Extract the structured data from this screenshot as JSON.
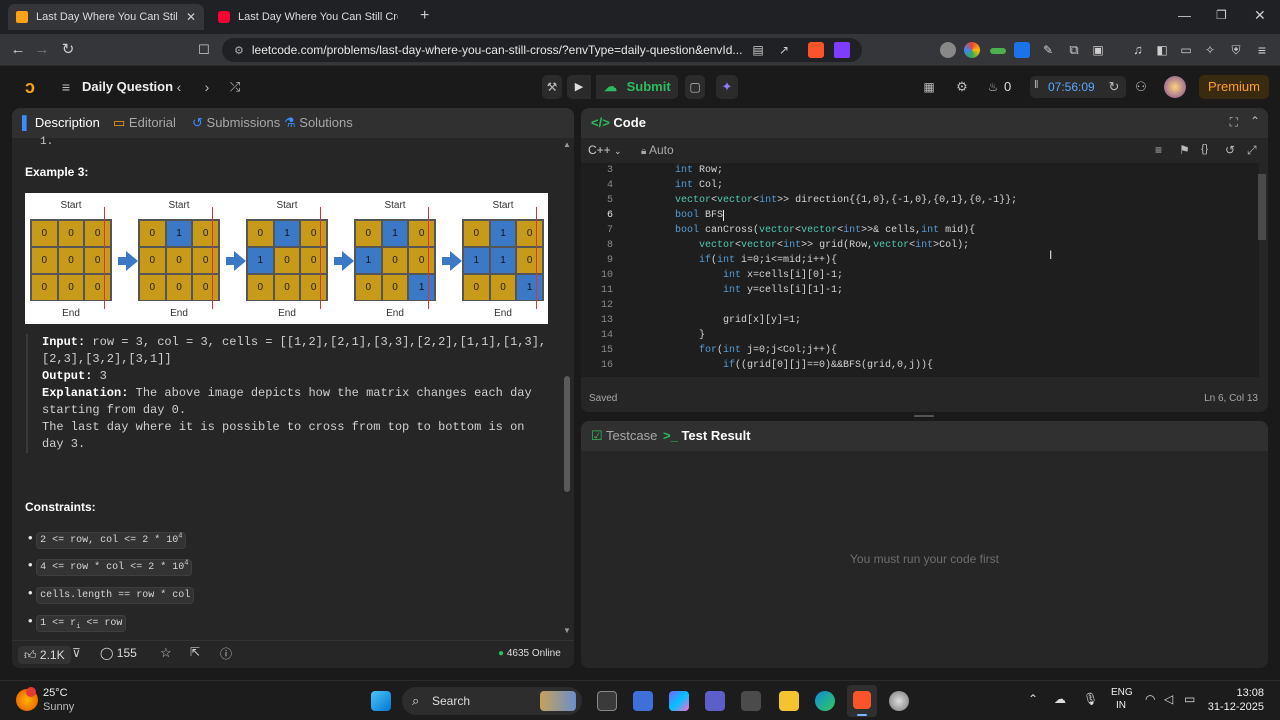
{
  "browser": {
    "tabs": [
      {
        "title": "Last Day Where You Can Still Cro",
        "active": true
      },
      {
        "title": "Last Day Where You Can Still Cross |",
        "active": false
      }
    ],
    "url": "leetcode.com/problems/last-day-where-you-can-still-cross/?envType=daily-question&envId..."
  },
  "lc_header": {
    "daily_question": "Daily Question",
    "submit": "Submit",
    "streak_count": "0",
    "timer": "07:56:09",
    "premium": "Premium"
  },
  "left_panel": {
    "tabs": [
      "Description",
      "Editorial",
      "Submissions",
      "Solutions"
    ],
    "scrolled_top": "1.",
    "example_title": "Example 3:",
    "diagram": {
      "start_label": "Start",
      "end_label": "End",
      "matrices": [
        [
          "0",
          "0",
          "0",
          "0",
          "0",
          "0",
          "0",
          "0",
          "0"
        ],
        [
          "0",
          "1",
          "0",
          "0",
          "0",
          "0",
          "0",
          "0",
          "0"
        ],
        [
          "0",
          "1",
          "0",
          "1",
          "0",
          "0",
          "0",
          "0",
          "0"
        ],
        [
          "0",
          "1",
          "0",
          "1",
          "0",
          "0",
          "0",
          "0",
          "1"
        ],
        [
          "0",
          "1",
          "0",
          "1",
          "1",
          "0",
          "0",
          "0",
          "1"
        ]
      ],
      "water_cells": [
        [],
        [
          1
        ],
        [
          1,
          3
        ],
        [
          1,
          3,
          8
        ],
        [
          1,
          3,
          4,
          8
        ]
      ]
    },
    "input_label": "Input:",
    "input_value": "row = 3, col = 3, cells = [[1,2],[2,1],[3,3],[2,2],[1,1],[1,3],[2,3],[3,2],[3,1]]",
    "output_label": "Output:",
    "output_value": "3",
    "explanation_label": "Explanation:",
    "explanation_value": "The above image depicts how the matrix changes each day starting from day 0.",
    "explanation_line2": "The last day where it is possible to cross from top to bottom is on day 3.",
    "constraints_title": "Constraints:",
    "constraints": [
      {
        "text": "2 <= row, col <= 2 * 10",
        "sup": "4"
      },
      {
        "text": "4 <= row * col <= 2 * 10",
        "sup": "4"
      },
      {
        "text": "cells.length == row * col",
        "sup": ""
      },
      {
        "text": "1 <= r",
        "sub": "i",
        "rest": " <= row"
      }
    ],
    "footer": {
      "likes": "2.1K",
      "comments": "155",
      "online": "4635 Online"
    }
  },
  "code_panel": {
    "title": "Code",
    "language": "C++",
    "mode": "Auto",
    "lines": [
      {
        "n": "3",
        "indent": 4,
        "code": "int Row;"
      },
      {
        "n": "4",
        "indent": 4,
        "code": "int Col;"
      },
      {
        "n": "5",
        "indent": 4,
        "code": "vector<vector<int>> direction{{1,0},{-1,0},{0,1},{0,-1}};"
      },
      {
        "n": "6",
        "indent": 4,
        "code": "bool BFS"
      },
      {
        "n": "7",
        "indent": 4,
        "code": "bool canCross(vector<vector<int>>& cells,int mid){"
      },
      {
        "n": "8",
        "indent": 8,
        "code": "vector<vector<int>> grid(Row,vector<int>Col);"
      },
      {
        "n": "9",
        "indent": 8,
        "code": "if(int i=0;i<=mid;i++){"
      },
      {
        "n": "10",
        "indent": 12,
        "code": "int x=cells[i][0]-1;"
      },
      {
        "n": "11",
        "indent": 12,
        "code": "int y=cells[i][1]-1;"
      },
      {
        "n": "12",
        "indent": 0,
        "code": ""
      },
      {
        "n": "13",
        "indent": 12,
        "code": "grid[x][y]=1;"
      },
      {
        "n": "14",
        "indent": 8,
        "code": "}"
      },
      {
        "n": "15",
        "indent": 8,
        "code": "for(int j=0;j<Col;j++){"
      },
      {
        "n": "16",
        "indent": 12,
        "code": "if((grid[0][j]==0)&&BFS(grid,0,j)){"
      }
    ],
    "current_line": "6",
    "status": "Saved",
    "cursor_pos": "Ln 6, Col 13"
  },
  "result_panel": {
    "tabs": [
      "Testcase",
      "Test Result"
    ],
    "empty_message": "You must run your code first"
  },
  "taskbar": {
    "weather_temp": "25°C",
    "weather_desc": "Sunny",
    "search": "Search",
    "lang": "ENG",
    "region": "IN",
    "time": "13:08",
    "date": "31-12-2025"
  }
}
